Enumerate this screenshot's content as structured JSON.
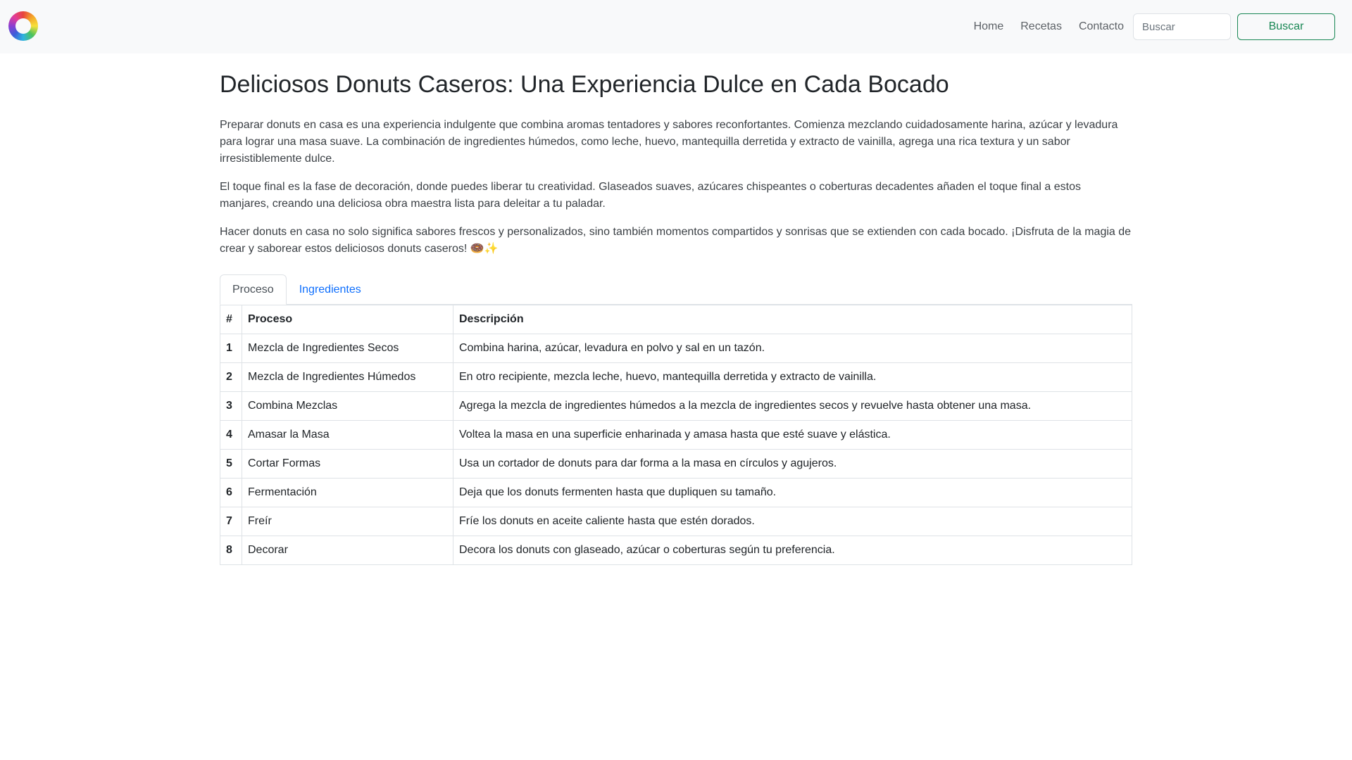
{
  "nav": {
    "links": [
      "Home",
      "Recetas",
      "Contacto"
    ],
    "search_placeholder": "Buscar",
    "search_button": "Buscar"
  },
  "main": {
    "title": "Deliciosos Donuts Caseros: Una Experiencia Dulce en Cada Bocado",
    "paragraphs": [
      "Preparar donuts en casa es una experiencia indulgente que combina aromas tentadores y sabores reconfortantes. Comienza mezclando cuidadosamente harina, azúcar y levadura para lograr una masa suave. La combinación de ingredientes húmedos, como leche, huevo, mantequilla derretida y extracto de vainilla, agrega una rica textura y un sabor irresistiblemente dulce.",
      "El toque final es la fase de decoración, donde puedes liberar tu creatividad. Glaseados suaves, azúcares chispeantes o coberturas decadentes añaden el toque final a estos manjares, creando una deliciosa obra maestra lista para deleitar a tu paladar.",
      "Hacer donuts en casa no solo significa sabores frescos y personalizados, sino también momentos compartidos y sonrisas que se extienden con cada bocado. ¡Disfruta de la magia de crear y saborear estos deliciosos donuts caseros! 🍩✨"
    ]
  },
  "tabs": [
    {
      "label": "Proceso",
      "active": true
    },
    {
      "label": "Ingredientes",
      "active": false
    }
  ],
  "table": {
    "headers": [
      "#",
      "Proceso",
      "Descripción"
    ],
    "rows": [
      [
        "1",
        "Mezcla de Ingredientes Secos",
        "Combina harina, azúcar, levadura en polvo y sal en un tazón."
      ],
      [
        "2",
        "Mezcla de Ingredientes Húmedos",
        "En otro recipiente, mezcla leche, huevo, mantequilla derretida y extracto de vainilla."
      ],
      [
        "3",
        "Combina Mezclas",
        "Agrega la mezcla de ingredientes húmedos a la mezcla de ingredientes secos y revuelve hasta obtener una masa."
      ],
      [
        "4",
        "Amasar la Masa",
        "Voltea la masa en una superficie enharinada y amasa hasta que esté suave y elástica."
      ],
      [
        "5",
        "Cortar Formas",
        "Usa un cortador de donuts para dar forma a la masa en círculos y agujeros."
      ],
      [
        "6",
        "Fermentación",
        "Deja que los donuts fermenten hasta que dupliquen su tamaño."
      ],
      [
        "7",
        "Freír",
        "Fríe los donuts en aceite caliente hasta que estén dorados."
      ],
      [
        "8",
        "Decorar",
        "Decora los donuts con glaseado, azúcar o coberturas según tu preferencia."
      ]
    ]
  },
  "colors": {
    "navbar_bg": "#f8f9fa",
    "accent_green": "#198754",
    "tab_link": "#0d6efd"
  }
}
